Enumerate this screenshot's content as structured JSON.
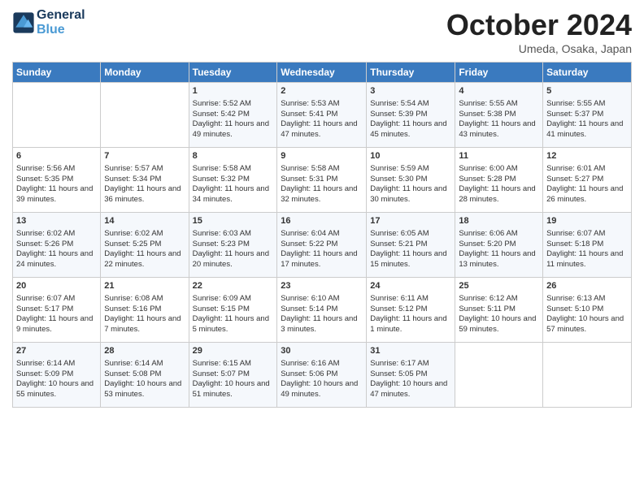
{
  "header": {
    "logo_line1": "General",
    "logo_line2": "Blue",
    "month": "October 2024",
    "location": "Umeda, Osaka, Japan"
  },
  "weekdays": [
    "Sunday",
    "Monday",
    "Tuesday",
    "Wednesday",
    "Thursday",
    "Friday",
    "Saturday"
  ],
  "weeks": [
    [
      {
        "day": "",
        "info": ""
      },
      {
        "day": "",
        "info": ""
      },
      {
        "day": "1",
        "info": "Sunrise: 5:52 AM\nSunset: 5:42 PM\nDaylight: 11 hours and 49 minutes."
      },
      {
        "day": "2",
        "info": "Sunrise: 5:53 AM\nSunset: 5:41 PM\nDaylight: 11 hours and 47 minutes."
      },
      {
        "day": "3",
        "info": "Sunrise: 5:54 AM\nSunset: 5:39 PM\nDaylight: 11 hours and 45 minutes."
      },
      {
        "day": "4",
        "info": "Sunrise: 5:55 AM\nSunset: 5:38 PM\nDaylight: 11 hours and 43 minutes."
      },
      {
        "day": "5",
        "info": "Sunrise: 5:55 AM\nSunset: 5:37 PM\nDaylight: 11 hours and 41 minutes."
      }
    ],
    [
      {
        "day": "6",
        "info": "Sunrise: 5:56 AM\nSunset: 5:35 PM\nDaylight: 11 hours and 39 minutes."
      },
      {
        "day": "7",
        "info": "Sunrise: 5:57 AM\nSunset: 5:34 PM\nDaylight: 11 hours and 36 minutes."
      },
      {
        "day": "8",
        "info": "Sunrise: 5:58 AM\nSunset: 5:32 PM\nDaylight: 11 hours and 34 minutes."
      },
      {
        "day": "9",
        "info": "Sunrise: 5:58 AM\nSunset: 5:31 PM\nDaylight: 11 hours and 32 minutes."
      },
      {
        "day": "10",
        "info": "Sunrise: 5:59 AM\nSunset: 5:30 PM\nDaylight: 11 hours and 30 minutes."
      },
      {
        "day": "11",
        "info": "Sunrise: 6:00 AM\nSunset: 5:28 PM\nDaylight: 11 hours and 28 minutes."
      },
      {
        "day": "12",
        "info": "Sunrise: 6:01 AM\nSunset: 5:27 PM\nDaylight: 11 hours and 26 minutes."
      }
    ],
    [
      {
        "day": "13",
        "info": "Sunrise: 6:02 AM\nSunset: 5:26 PM\nDaylight: 11 hours and 24 minutes."
      },
      {
        "day": "14",
        "info": "Sunrise: 6:02 AM\nSunset: 5:25 PM\nDaylight: 11 hours and 22 minutes."
      },
      {
        "day": "15",
        "info": "Sunrise: 6:03 AM\nSunset: 5:23 PM\nDaylight: 11 hours and 20 minutes."
      },
      {
        "day": "16",
        "info": "Sunrise: 6:04 AM\nSunset: 5:22 PM\nDaylight: 11 hours and 17 minutes."
      },
      {
        "day": "17",
        "info": "Sunrise: 6:05 AM\nSunset: 5:21 PM\nDaylight: 11 hours and 15 minutes."
      },
      {
        "day": "18",
        "info": "Sunrise: 6:06 AM\nSunset: 5:20 PM\nDaylight: 11 hours and 13 minutes."
      },
      {
        "day": "19",
        "info": "Sunrise: 6:07 AM\nSunset: 5:18 PM\nDaylight: 11 hours and 11 minutes."
      }
    ],
    [
      {
        "day": "20",
        "info": "Sunrise: 6:07 AM\nSunset: 5:17 PM\nDaylight: 11 hours and 9 minutes."
      },
      {
        "day": "21",
        "info": "Sunrise: 6:08 AM\nSunset: 5:16 PM\nDaylight: 11 hours and 7 minutes."
      },
      {
        "day": "22",
        "info": "Sunrise: 6:09 AM\nSunset: 5:15 PM\nDaylight: 11 hours and 5 minutes."
      },
      {
        "day": "23",
        "info": "Sunrise: 6:10 AM\nSunset: 5:14 PM\nDaylight: 11 hours and 3 minutes."
      },
      {
        "day": "24",
        "info": "Sunrise: 6:11 AM\nSunset: 5:12 PM\nDaylight: 11 hours and 1 minute."
      },
      {
        "day": "25",
        "info": "Sunrise: 6:12 AM\nSunset: 5:11 PM\nDaylight: 10 hours and 59 minutes."
      },
      {
        "day": "26",
        "info": "Sunrise: 6:13 AM\nSunset: 5:10 PM\nDaylight: 10 hours and 57 minutes."
      }
    ],
    [
      {
        "day": "27",
        "info": "Sunrise: 6:14 AM\nSunset: 5:09 PM\nDaylight: 10 hours and 55 minutes."
      },
      {
        "day": "28",
        "info": "Sunrise: 6:14 AM\nSunset: 5:08 PM\nDaylight: 10 hours and 53 minutes."
      },
      {
        "day": "29",
        "info": "Sunrise: 6:15 AM\nSunset: 5:07 PM\nDaylight: 10 hours and 51 minutes."
      },
      {
        "day": "30",
        "info": "Sunrise: 6:16 AM\nSunset: 5:06 PM\nDaylight: 10 hours and 49 minutes."
      },
      {
        "day": "31",
        "info": "Sunrise: 6:17 AM\nSunset: 5:05 PM\nDaylight: 10 hours and 47 minutes."
      },
      {
        "day": "",
        "info": ""
      },
      {
        "day": "",
        "info": ""
      }
    ]
  ]
}
